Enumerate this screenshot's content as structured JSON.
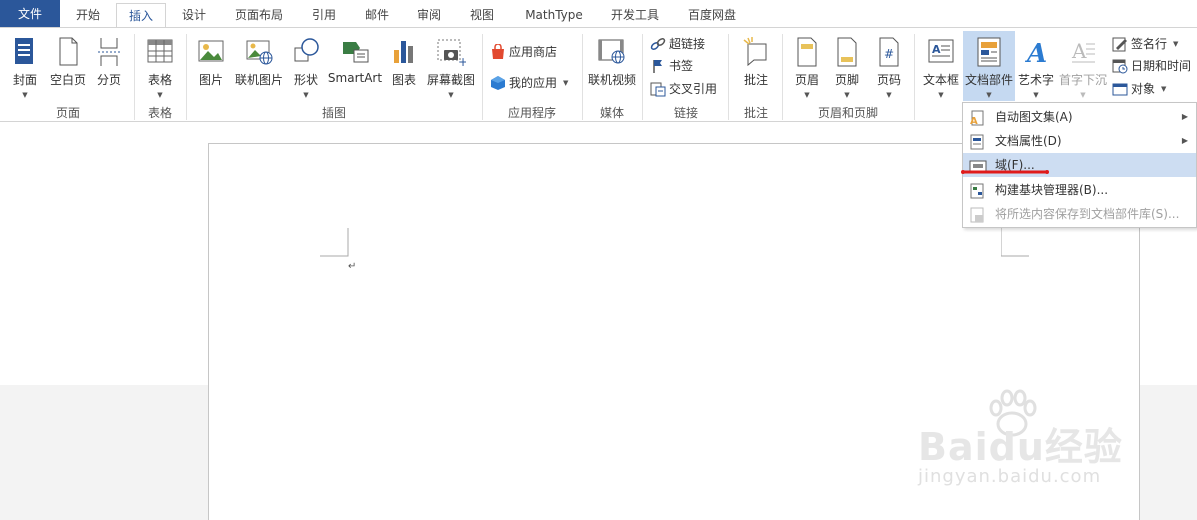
{
  "tabs": [
    "文件",
    "开始",
    "插入",
    "设计",
    "页面布局",
    "引用",
    "邮件",
    "审阅",
    "视图",
    "MathType",
    "开发工具",
    "百度网盘"
  ],
  "active_tab": "插入",
  "ribbon": {
    "page": {
      "cover": "封面",
      "blank": "空白页",
      "break": "分页",
      "group": "页面"
    },
    "table": {
      "table": "表格",
      "group": "表格"
    },
    "illus": {
      "picture": "图片",
      "online_picture": "联机图片",
      "shapes": "形状",
      "smartart": "SmartArt",
      "chart": "图表",
      "screenshot": "屏幕截图",
      "group": "插图"
    },
    "apps": {
      "store": "应用商店",
      "my_apps": "我的应用",
      "group": "应用程序"
    },
    "media": {
      "online_video": "联机视频",
      "group": "媒体"
    },
    "links": {
      "hyperlink": "超链接",
      "bookmark": "书签",
      "crossref": "交叉引用",
      "group": "链接"
    },
    "comments": {
      "comment": "批注",
      "group": "批注"
    },
    "hf": {
      "header": "页眉",
      "footer": "页脚",
      "page_number": "页码",
      "group": "页眉和页脚"
    },
    "text": {
      "textbox": "文本框",
      "quick_parts": "文档部件",
      "wordart": "艺术字",
      "dropcap": "首字下沉",
      "signature": "签名行",
      "datetime": "日期和时间",
      "object": "对象"
    }
  },
  "dropdown": {
    "autotext": "自动图文集(A)",
    "docprop": "文档属性(D)",
    "field": "域(F)...",
    "building_blocks": "构建基块管理器(B)...",
    "save_selection": "将所选内容保存到文档部件库(S)..."
  },
  "document": {
    "paragraph_mark": "↵"
  },
  "watermark": {
    "brand": "Baidu经验",
    "url": "jingyan.baidu.com"
  },
  "colors": {
    "file_tab": "#2b579a",
    "accent": "#2b579a",
    "highlight": "#c5d9f1",
    "annotation": "#e01b1b"
  }
}
